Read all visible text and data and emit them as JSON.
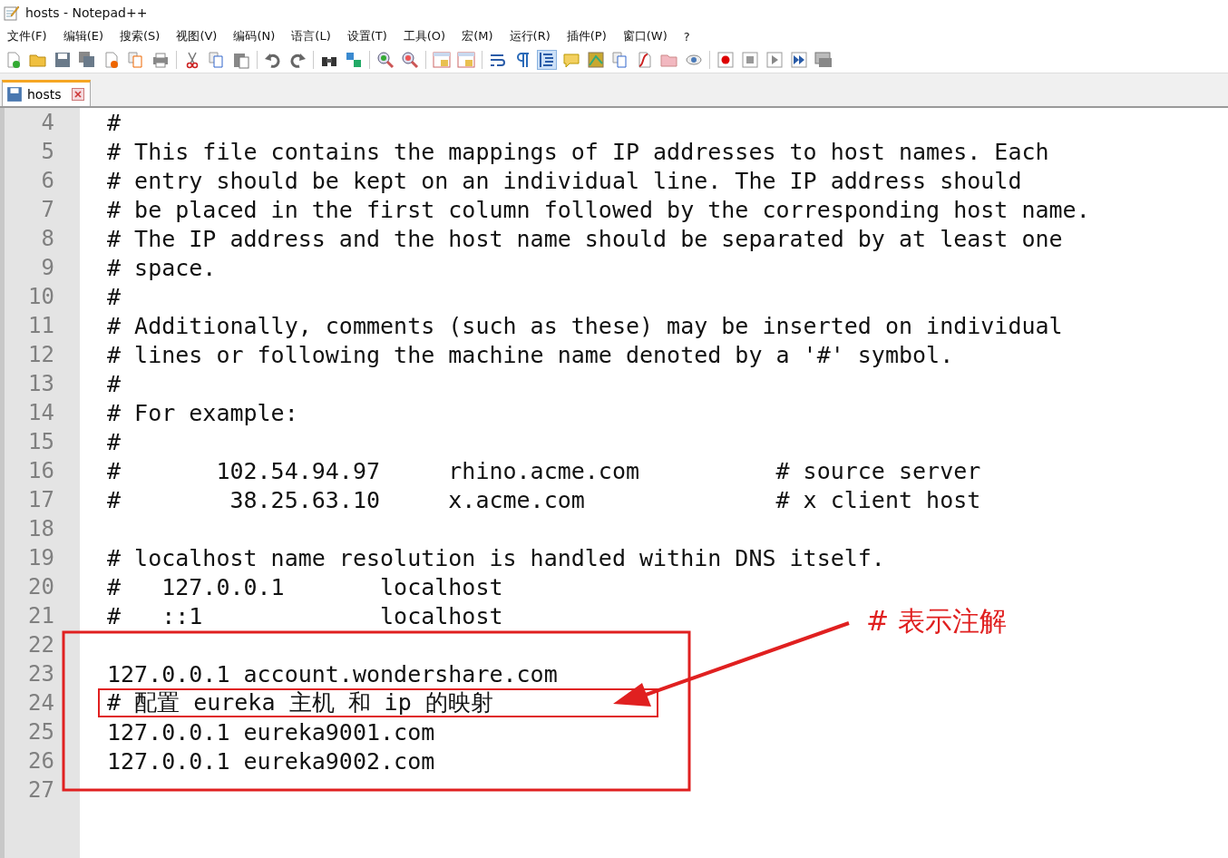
{
  "window": {
    "title": "hosts - Notepad++"
  },
  "menu": [
    "文件(F)",
    "编辑(E)",
    "搜索(S)",
    "视图(V)",
    "编码(N)",
    "语言(L)",
    "设置(T)",
    "工具(O)",
    "宏(M)",
    "运行(R)",
    "插件(P)",
    "窗口(W)",
    "?"
  ],
  "tabs": [
    {
      "label": "hosts",
      "selected": true
    }
  ],
  "lines": [
    {
      "number": "4",
      "text": "#"
    },
    {
      "number": "5",
      "text": "# This file contains the mappings of IP addresses to host names. Each"
    },
    {
      "number": "6",
      "text": "# entry should be kept on an individual line. The IP address should"
    },
    {
      "number": "7",
      "text": "# be placed in the first column followed by the corresponding host name."
    },
    {
      "number": "8",
      "text": "# The IP address and the host name should be separated by at least one"
    },
    {
      "number": "9",
      "text": "# space."
    },
    {
      "number": "10",
      "text": "#"
    },
    {
      "number": "11",
      "text": "# Additionally, comments (such as these) may be inserted on individual"
    },
    {
      "number": "12",
      "text": "# lines or following the machine name denoted by a '#' symbol."
    },
    {
      "number": "13",
      "text": "#"
    },
    {
      "number": "14",
      "text": "# For example:"
    },
    {
      "number": "15",
      "text": "#"
    },
    {
      "number": "16",
      "text": "#       102.54.94.97     rhino.acme.com          # source server"
    },
    {
      "number": "17",
      "text": "#        38.25.63.10     x.acme.com              # x client host"
    },
    {
      "number": "18"
    },
    {
      "number": "19",
      "text": "# localhost name resolution is handled within DNS itself."
    },
    {
      "number": "20",
      "text": "#   127.0.0.1       localhost"
    },
    {
      "number": "21",
      "text": "#   ::1             localhost"
    },
    {
      "number": "22"
    },
    {
      "number": "23",
      "text": "127.0.0.1 account.wondershare.com"
    },
    {
      "number": "24",
      "text": "# 配置 eureka 主机 和 ip 的映射",
      "boxed": true
    },
    {
      "number": "25",
      "text": "127.0.0.1 eureka9001.com"
    },
    {
      "number": "26",
      "text": "127.0.0.1 eureka9002.com"
    },
    {
      "number": "27"
    }
  ],
  "annotation": {
    "label": "# 表示注解"
  }
}
